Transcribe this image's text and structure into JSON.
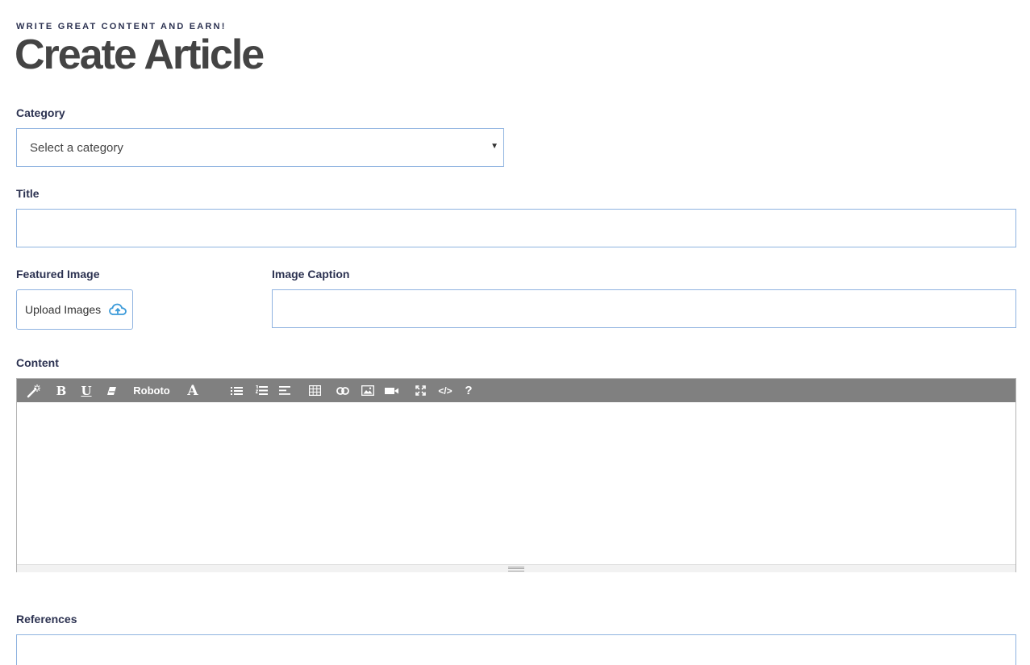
{
  "header": {
    "eyebrow": "WRITE GREAT CONTENT AND EARN!",
    "title": "Create Article"
  },
  "form": {
    "category": {
      "label": "Category",
      "selected": "Select a category"
    },
    "title": {
      "label": "Title",
      "value": ""
    },
    "featured_image": {
      "label": "Featured Image",
      "button_label": "Upload Images",
      "icon": "cloud-upload-icon"
    },
    "image_caption": {
      "label": "Image Caption",
      "value": ""
    },
    "content": {
      "label": "Content",
      "toolbar": {
        "font_name": "Roboto",
        "bold": "B",
        "underline": "U",
        "font_color": "A",
        "help": "?",
        "code": "</>"
      },
      "toolbar_color": "#808080"
    },
    "references": {
      "label": "References"
    }
  },
  "colors": {
    "label": "#2c3251",
    "title": "#444444",
    "field_border": "#8fb3e0",
    "accent": "#3a9ad9"
  }
}
